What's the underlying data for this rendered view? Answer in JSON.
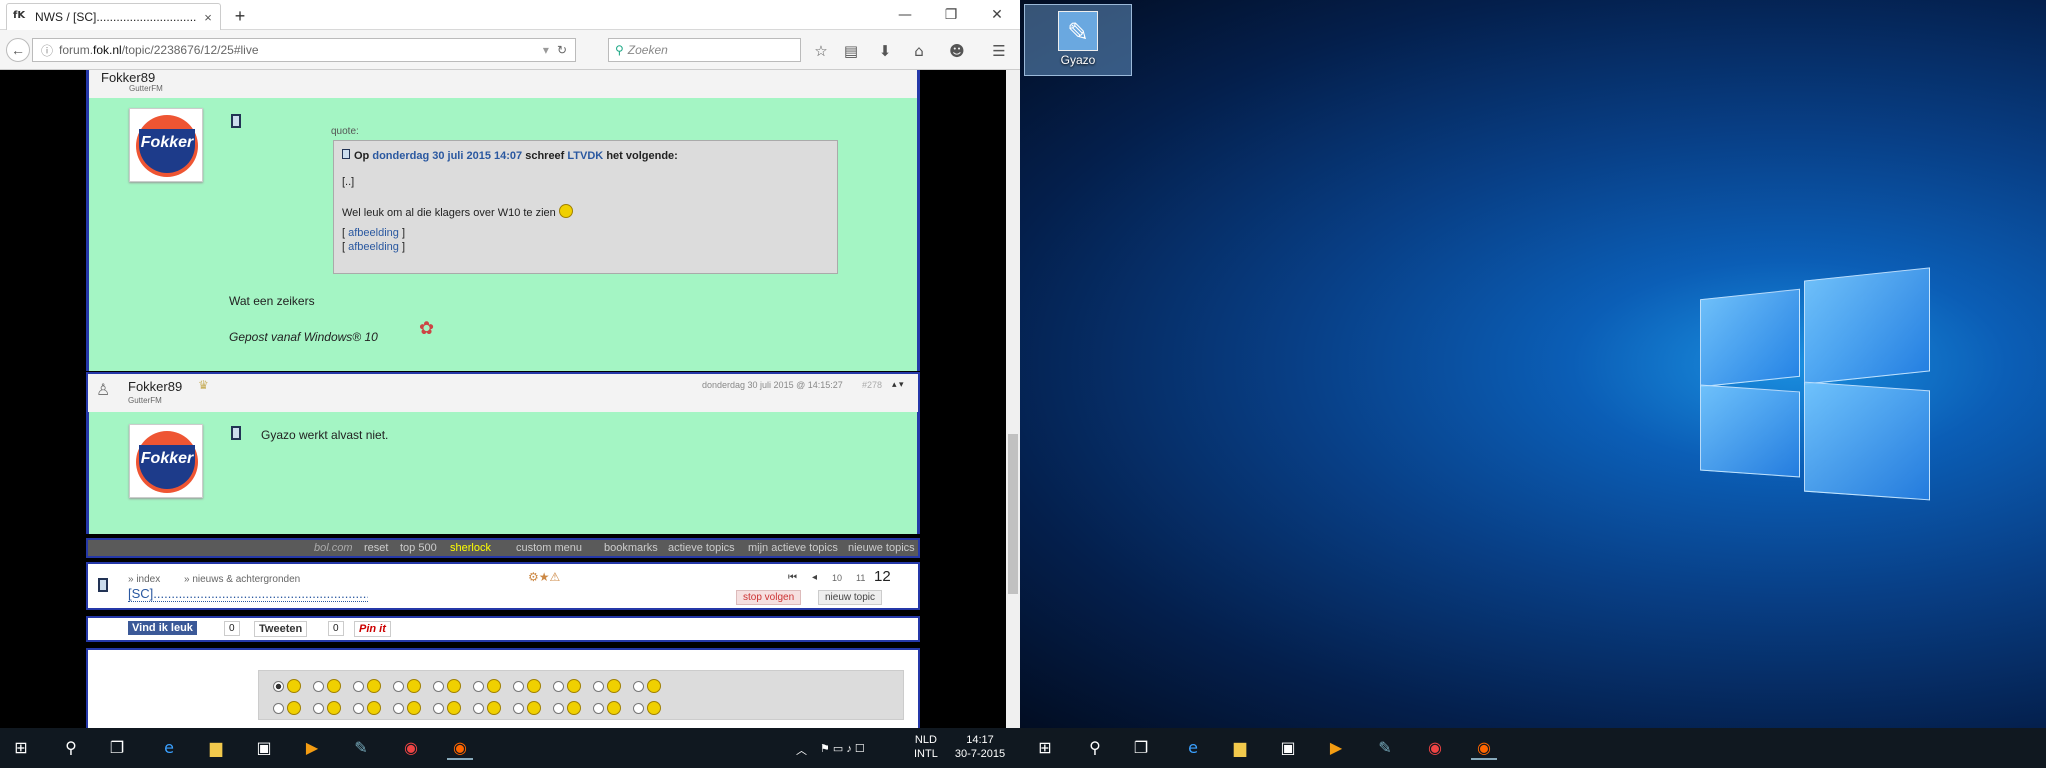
{
  "browser": {
    "tab_title": "NWS / [SC]..............................",
    "tab_favicon": "fok-icon",
    "new_tab": "+",
    "url_prefix": "forum.",
    "url_host": "fok.nl",
    "url_path": "/topic/2238676/12/25#live",
    "search_placeholder": "Zoeken",
    "win_min": "—",
    "win_max": "❐",
    "win_close": "✕"
  },
  "posts": [
    {
      "user": "Fokker89",
      "subtitle": "GutterFM",
      "quote_label": "quote:",
      "quote_prefix": "Op",
      "quote_date": "donderdag 30 juli 2015 14:07",
      "quote_mid": "schreef",
      "quote_user": "LTVDK",
      "quote_suffix": "het volgende:",
      "quote_ellipsis": "[..]",
      "quote_text": "Wel leuk om al die klagers over W10 te zien",
      "quote_img1_open": "[",
      "quote_img1": "afbeelding",
      "quote_img1_close": "]",
      "quote_img2_open": "[",
      "quote_img2": "afbeelding",
      "quote_img2_close": "]",
      "body": "Wat een zeikers",
      "sig": "Gepost vanaf Windows® 10"
    },
    {
      "user": "Fokker89",
      "subtitle": "GutterFM",
      "timestamp": "donderdag 30 juli 2015 @ 14:15:27",
      "post_no": "#278",
      "arrows": "▴ ▾",
      "body": "Gyazo werkt alvast niet."
    }
  ],
  "menubar": {
    "items_left": [
      "bol.com",
      "reset",
      "top 500",
      "sherlock"
    ],
    "items_right": [
      "custom menu",
      "bookmarks",
      "actieve topics",
      "mijn actieve topics",
      "nieuwe topics"
    ]
  },
  "crumb": {
    "index": "» index",
    "section": "» nieuws & achtergronden",
    "topic": "[SC]..............................................................................",
    "pages": [
      "10",
      "11"
    ],
    "current_page": "12",
    "first": "⏮",
    "prev": "◂",
    "stop_follow": "stop volgen",
    "new_topic": "nieuw topic"
  },
  "social": {
    "like": "Vind ik leuk",
    "like_count": "0",
    "tweet": "Tweeten",
    "tweet_count": "0",
    "pin": "Pin it"
  },
  "desktop": {
    "icon_label": "Gyazo"
  },
  "tray": {
    "lang1": "NLD",
    "lang2": "INTL",
    "time": "14:17",
    "date": "30-7-2015"
  },
  "colors": {
    "post_bg": "#a4f5c4",
    "border": "#2538a8",
    "link": "#2a58a0",
    "taskbar": "#101820"
  }
}
